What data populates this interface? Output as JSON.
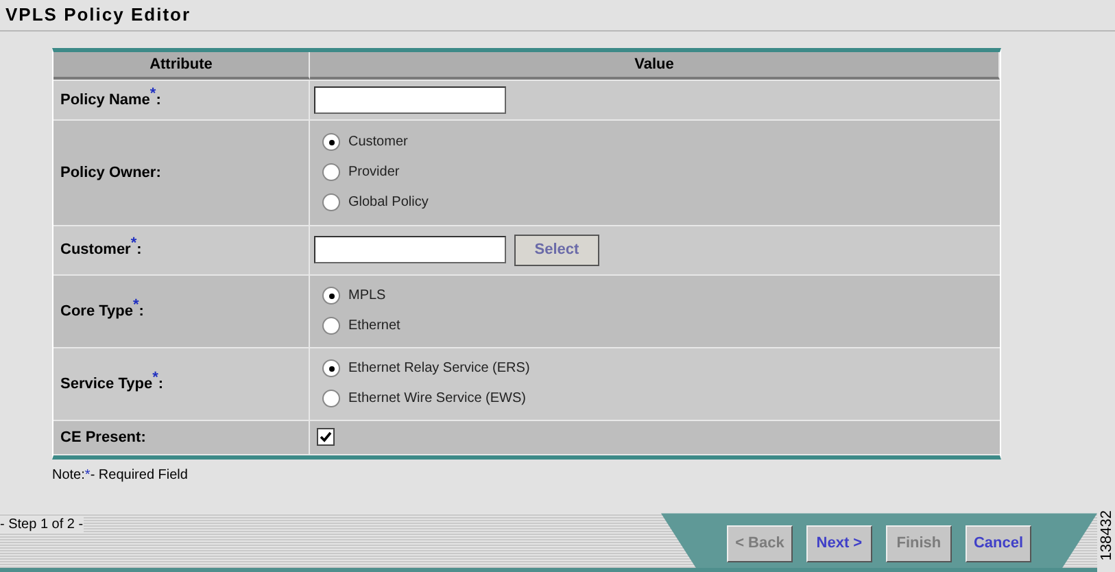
{
  "title": "VPLS Policy Editor",
  "table": {
    "columns": [
      "Attribute",
      "Value"
    ],
    "rows": [
      {
        "label": "Policy Name$^{*}$:",
        "kind": "text",
        "value": ""
      },
      {
        "label": "Policy Owner:",
        "kind": "radio",
        "options": [
          {
            "label": "Customer",
            "selected": true
          },
          {
            "label": "Provider",
            "selected": false
          },
          {
            "label": "Global Policy",
            "selected": false
          }
        ]
      },
      {
        "label": "Customer$^{*}$:",
        "kind": "select",
        "value": "",
        "button": "Select"
      },
      {
        "label": "Core Type$^{*}$:",
        "kind": "radio",
        "options": [
          {
            "label": "MPLS",
            "selected": true
          },
          {
            "label": "Ethernet",
            "selected": false
          }
        ]
      },
      {
        "label": "Service Type$^{*}$:",
        "kind": "radio",
        "options": [
          {
            "label": "Ethernet Relay Service (ERS)",
            "selected": true
          },
          {
            "label": "Ethernet Wire Service (EWS)",
            "selected": false
          }
        ]
      },
      {
        "label": "CE Present:",
        "kind": "checkbox",
        "checked": true
      }
    ]
  },
  "note": {
    "prefix": "Note:",
    "mark": "*",
    "text": "- Required Field"
  },
  "step": "- Step 1 of 2 -",
  "buttons": [
    {
      "label": "< Back",
      "disabled": true
    },
    {
      "label": "Next >",
      "disabled": false
    },
    {
      "label": "Finish",
      "disabled": true
    },
    {
      "label": "Cancel",
      "disabled": false
    }
  ],
  "figure_id": "138432"
}
